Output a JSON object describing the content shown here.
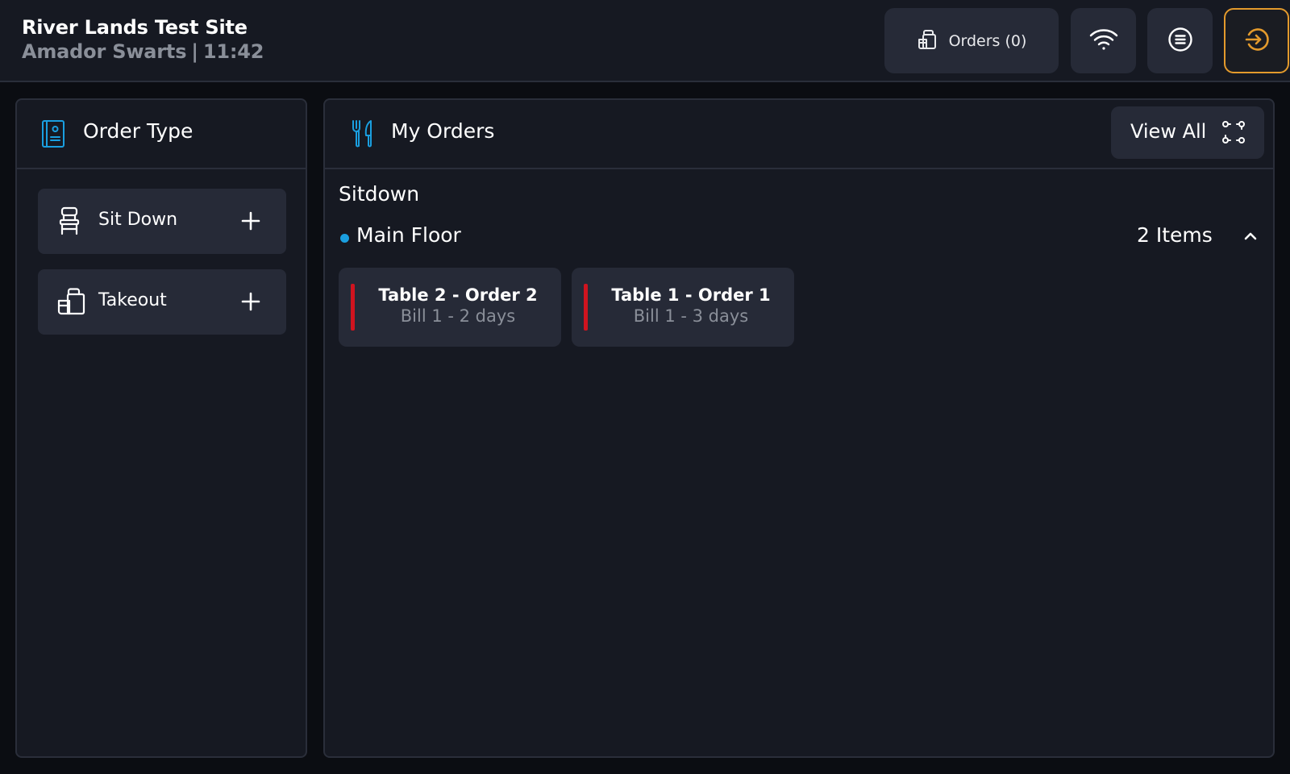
{
  "header": {
    "site_name": "River Lands Test Site",
    "user_name": "Amador Swarts",
    "separator": "|",
    "time": "11:42",
    "orders_label": "Orders (0)"
  },
  "colors": {
    "accent_blue": "#1a9fe0",
    "exit_orange": "#e39a2c",
    "order_bar_red": "#d0141f"
  },
  "order_type": {
    "title": "Order Type",
    "icon": "order-book-icon",
    "items": [
      {
        "label": "Sit Down",
        "icon": "chair-icon"
      },
      {
        "label": "Takeout",
        "icon": "takeout-bag-icon"
      }
    ]
  },
  "my_orders": {
    "title": "My Orders",
    "icon": "fork-knife-icon",
    "view_all_label": "View All",
    "section": "Sitdown",
    "floor": {
      "name": "Main Floor",
      "count_label": "2 Items",
      "expanded": true
    },
    "orders": [
      {
        "title": "Table 2 - Order 2",
        "subtitle": "Bill 1 - 2 days"
      },
      {
        "title": "Table 1 - Order 1",
        "subtitle": "Bill 1 - 3 days"
      }
    ]
  }
}
